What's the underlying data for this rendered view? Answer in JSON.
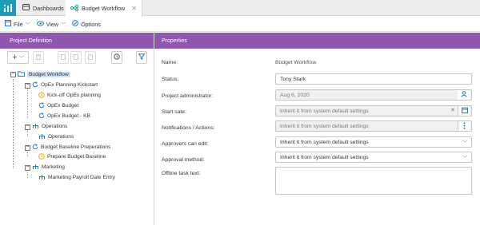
{
  "tabs": [
    {
      "label": "Dashboards"
    },
    {
      "label": "Budget Workflow"
    }
  ],
  "toolbar": {
    "file": "File",
    "view": "View",
    "options": "Options"
  },
  "left_panel": {
    "title": "Project Definition"
  },
  "right_panel": {
    "title": "Properties"
  },
  "tree": {
    "root": "Budget Workflow",
    "nodes": [
      {
        "label": "OpEx Planning Kickstart"
      },
      {
        "label": "Kick-off OpEx planning"
      },
      {
        "label": "OpEx Budget"
      },
      {
        "label": "OpEx Budget - KB"
      },
      {
        "label": "Operations"
      },
      {
        "label": "Operations"
      },
      {
        "label": "Budget Baseline Preperations"
      },
      {
        "label": "Prepare Budget Baseline"
      },
      {
        "label": "Marketing"
      },
      {
        "label": "Marketing Payroll Date Entry"
      }
    ]
  },
  "properties": {
    "name_label": "Name:",
    "name_value": "Budget Workflow",
    "status_label": "Status:",
    "status_value": "Tony Stark",
    "admin_label": "Project administrator:",
    "admin_value": "Aug 6, 2020",
    "start_label": "Start sate:",
    "start_value": "Inherit it from system default settings",
    "notif_label": "Notifications / Actions:",
    "notif_value": "Inherit it from system default settings",
    "approvers_label": "Approvers can edit:",
    "approvers_value": "Inherit it from system default settings",
    "approval_label": "Approval method:",
    "approval_value": "Inherit it from system default settings",
    "offline_label": "Offline task text:",
    "offline_value": ""
  },
  "colors": {
    "accent": "#8f57ad",
    "app_icon": "#1e9bb5",
    "selection": "#cfe3f7"
  }
}
